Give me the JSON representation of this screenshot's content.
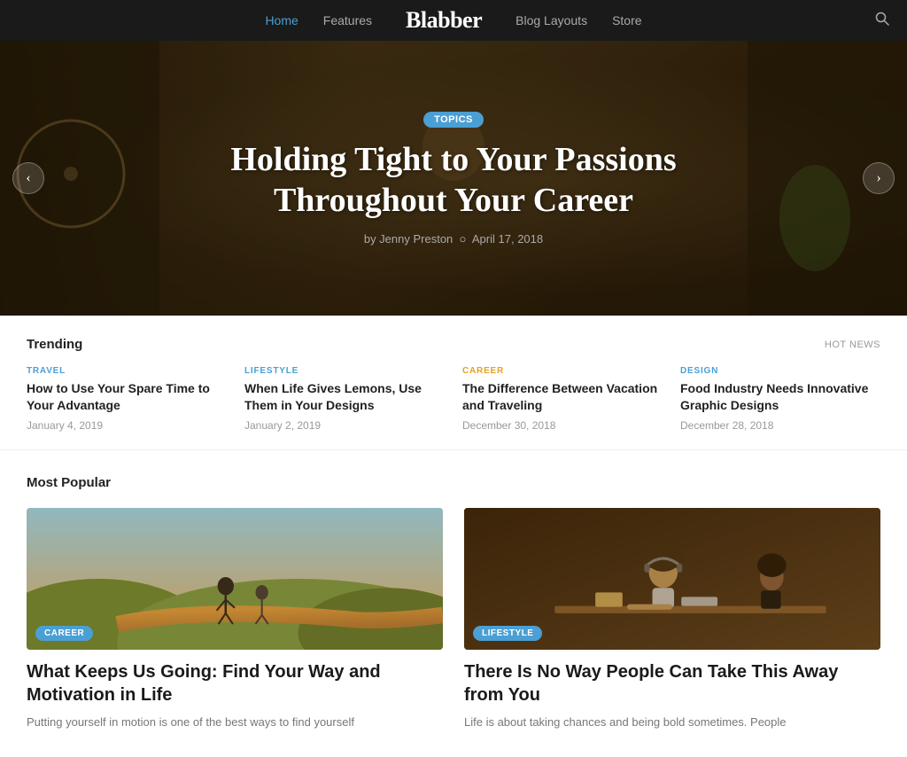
{
  "nav": {
    "links": [
      {
        "label": "Home",
        "active": true
      },
      {
        "label": "Features",
        "active": false
      },
      {
        "label": "Blog Layouts",
        "active": false
      },
      {
        "label": "Store",
        "active": false
      }
    ],
    "logo": "Blabber",
    "search_icon": "🔍"
  },
  "hero": {
    "badge": "TOPICS",
    "title_line1": "Holding Tight to Your Passions",
    "title_line2": "Throughout Your Career",
    "author": "by Jenny Preston",
    "date": "April 17, 2018",
    "arrow_left": "‹",
    "arrow_right": "›"
  },
  "trending": {
    "section_title": "Trending",
    "hot_news_label": "HOT NEWS",
    "items": [
      {
        "category": "TRAVEL",
        "category_class": "cat-travel",
        "title": "How to Use Your Spare Time to Your Advantage",
        "date": "January 4, 2019"
      },
      {
        "category": "LIFESTYLE",
        "category_class": "cat-lifestyle",
        "title": "When Life Gives Lemons, Use Them in Your Designs",
        "date": "January 2, 2019"
      },
      {
        "category": "CAREER",
        "category_class": "cat-career",
        "title": "The Difference Between Vacation and Traveling",
        "date": "December 30, 2018"
      },
      {
        "category": "DESIGN",
        "category_class": "cat-design",
        "title": "Food Industry Needs Innovative Graphic Designs",
        "date": "December 28, 2018"
      }
    ]
  },
  "popular": {
    "section_title": "Most Popular",
    "cards": [
      {
        "category": "CAREER",
        "category_class": "career",
        "image_class": "img-running",
        "title": "What Keeps Us Going: Find Your Way and Motivation in Life",
        "excerpt": "Putting yourself in motion is one of the best ways to find yourself"
      },
      {
        "category": "LIFESTYLE",
        "category_class": "lifestyle",
        "image_class": "img-workshop",
        "title": "There Is No Way People Can Take This Away from You",
        "excerpt": "Life is about taking chances and being bold sometimes. People"
      }
    ]
  }
}
